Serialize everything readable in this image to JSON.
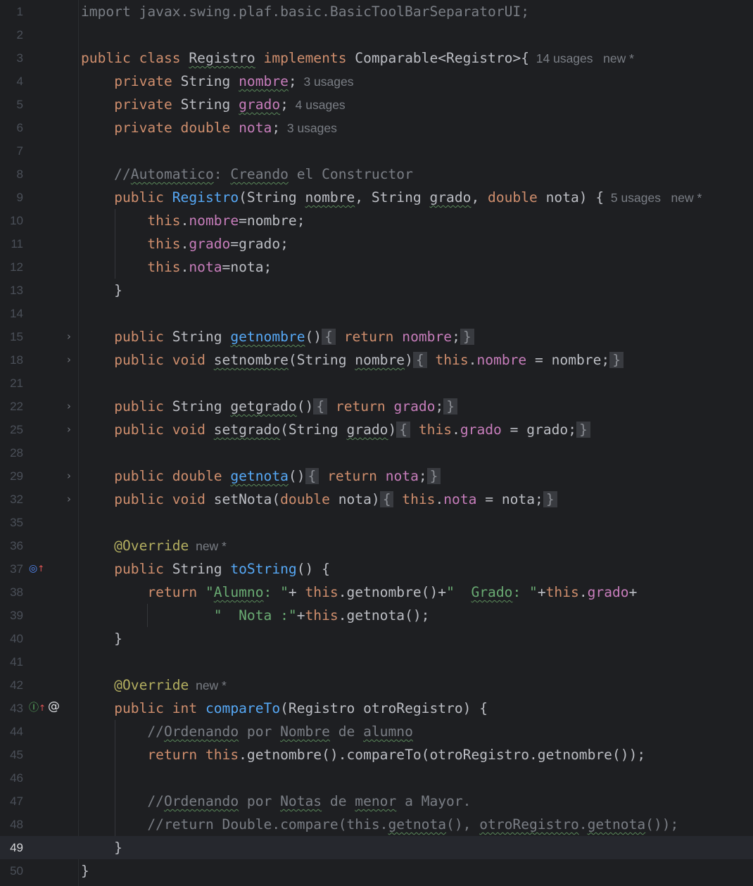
{
  "editor": {
    "language": "java",
    "current_line": "49",
    "colors": {
      "background": "#1e1f22",
      "keyword": "#cf8e6d",
      "field": "#c77dbb",
      "method": "#56a8f5",
      "string": "#6aab73",
      "comment": "#7a7e85",
      "annotation": "#b3ae60",
      "text": "#bcbec4"
    },
    "lines": [
      {
        "n": "1",
        "t": [
          [
            "cm",
            "import javax.swing.plaf.basic.BasicToolBarSeparatorUI;"
          ]
        ]
      },
      {
        "n": "2",
        "t": []
      },
      {
        "n": "3",
        "t": [
          [
            "kw",
            "public class "
          ],
          [
            "sq",
            "Registro"
          ],
          [
            "n",
            " "
          ],
          [
            "kw",
            "implements "
          ],
          [
            "n",
            "Comparable<Registro>{"
          ],
          [
            "h",
            "  14 usages   new *"
          ]
        ]
      },
      {
        "n": "4",
        "t": [
          [
            "n",
            "    "
          ],
          [
            "kw",
            "private "
          ],
          [
            "n",
            "String "
          ],
          [
            "fsq",
            "nombre"
          ],
          [
            "n",
            ";"
          ],
          [
            "h",
            "  3 usages"
          ]
        ]
      },
      {
        "n": "5",
        "t": [
          [
            "n",
            "    "
          ],
          [
            "kw",
            "private "
          ],
          [
            "n",
            "String "
          ],
          [
            "fsq",
            "grado"
          ],
          [
            "n",
            ";"
          ],
          [
            "h",
            "  4 usages"
          ]
        ]
      },
      {
        "n": "6",
        "t": [
          [
            "n",
            "    "
          ],
          [
            "kw",
            "private double "
          ],
          [
            "f",
            "nota"
          ],
          [
            "n",
            ";"
          ],
          [
            "h",
            "  3 usages"
          ]
        ]
      },
      {
        "n": "7",
        "t": []
      },
      {
        "n": "8",
        "t": [
          [
            "cm",
            "    //"
          ],
          [
            "cmsq",
            "Automatico"
          ],
          [
            "cm",
            ": "
          ],
          [
            "cmsq",
            "Creando"
          ],
          [
            "cm",
            " el Constructor"
          ]
        ]
      },
      {
        "n": "9",
        "t": [
          [
            "n",
            "    "
          ],
          [
            "kw",
            "public "
          ],
          [
            "fn",
            "Registro"
          ],
          [
            "n",
            "(String "
          ],
          [
            "sq",
            "nombre"
          ],
          [
            "n",
            ", String "
          ],
          [
            "sq",
            "grado"
          ],
          [
            "n",
            ", "
          ],
          [
            "kw",
            "double "
          ],
          [
            "n",
            "nota) {"
          ],
          [
            "h",
            "  5 usages   new *"
          ]
        ]
      },
      {
        "n": "10",
        "t": [
          [
            "n",
            "        "
          ],
          [
            "kw",
            "this"
          ],
          [
            "n",
            "."
          ],
          [
            "f",
            "nombre"
          ],
          [
            "n",
            "=nombre;"
          ]
        ]
      },
      {
        "n": "11",
        "t": [
          [
            "n",
            "        "
          ],
          [
            "kw",
            "this"
          ],
          [
            "n",
            "."
          ],
          [
            "f",
            "grado"
          ],
          [
            "n",
            "=grado;"
          ]
        ]
      },
      {
        "n": "12",
        "t": [
          [
            "n",
            "        "
          ],
          [
            "kw",
            "this"
          ],
          [
            "n",
            "."
          ],
          [
            "f",
            "nota"
          ],
          [
            "n",
            "=nota;"
          ]
        ]
      },
      {
        "n": "13",
        "t": [
          [
            "n",
            "    }"
          ]
        ]
      },
      {
        "n": "14",
        "t": []
      },
      {
        "n": "15",
        "fold": true,
        "t": [
          [
            "n",
            "    "
          ],
          [
            "kw",
            "public "
          ],
          [
            "n",
            "String "
          ],
          [
            "fnsq",
            "getnombre"
          ],
          [
            "n",
            "()"
          ],
          [
            "fb",
            "{"
          ],
          [
            "n",
            " "
          ],
          [
            "kw",
            "return "
          ],
          [
            "f",
            "nombre"
          ],
          [
            "n",
            ";"
          ],
          [
            "fb",
            "}"
          ]
        ]
      },
      {
        "n": "18",
        "fold": true,
        "t": [
          [
            "n",
            "    "
          ],
          [
            "kw",
            "public void "
          ],
          [
            "nmsq",
            "setnombre"
          ],
          [
            "n",
            "(String "
          ],
          [
            "sq",
            "nombre"
          ],
          [
            "n",
            ")"
          ],
          [
            "fb",
            "{"
          ],
          [
            "n",
            " "
          ],
          [
            "kw",
            "this"
          ],
          [
            "n",
            "."
          ],
          [
            "f",
            "nombre"
          ],
          [
            "n",
            " = nombre;"
          ],
          [
            "fb",
            "}"
          ]
        ]
      },
      {
        "n": "21",
        "t": []
      },
      {
        "n": "22",
        "fold": true,
        "t": [
          [
            "n",
            "    "
          ],
          [
            "kw",
            "public "
          ],
          [
            "n",
            "String "
          ],
          [
            "nmsq",
            "getgrado"
          ],
          [
            "n",
            "()"
          ],
          [
            "fb",
            "{"
          ],
          [
            "n",
            " "
          ],
          [
            "kw",
            "return "
          ],
          [
            "f",
            "grado"
          ],
          [
            "n",
            ";"
          ],
          [
            "fb",
            "}"
          ]
        ]
      },
      {
        "n": "25",
        "fold": true,
        "t": [
          [
            "n",
            "    "
          ],
          [
            "kw",
            "public void "
          ],
          [
            "nmsq",
            "setgrado"
          ],
          [
            "n",
            "(String "
          ],
          [
            "sq",
            "grado"
          ],
          [
            "n",
            ")"
          ],
          [
            "fb",
            "{"
          ],
          [
            "n",
            " "
          ],
          [
            "kw",
            "this"
          ],
          [
            "n",
            "."
          ],
          [
            "f",
            "grado"
          ],
          [
            "n",
            " = grado;"
          ],
          [
            "fb",
            "}"
          ]
        ]
      },
      {
        "n": "28",
        "t": []
      },
      {
        "n": "29",
        "fold": true,
        "t": [
          [
            "n",
            "    "
          ],
          [
            "kw",
            "public double "
          ],
          [
            "fnsq",
            "getnota"
          ],
          [
            "n",
            "()"
          ],
          [
            "fb",
            "{"
          ],
          [
            "n",
            " "
          ],
          [
            "kw",
            "return "
          ],
          [
            "f",
            "nota"
          ],
          [
            "n",
            ";"
          ],
          [
            "fb",
            "}"
          ]
        ]
      },
      {
        "n": "32",
        "fold": true,
        "t": [
          [
            "n",
            "    "
          ],
          [
            "kw",
            "public void "
          ],
          [
            "nm",
            "setNota"
          ],
          [
            "n",
            "("
          ],
          [
            "kw",
            "double "
          ],
          [
            "n",
            "nota)"
          ],
          [
            "fb",
            "{"
          ],
          [
            "n",
            " "
          ],
          [
            "kw",
            "this"
          ],
          [
            "n",
            "."
          ],
          [
            "f",
            "nota"
          ],
          [
            "n",
            " = nota;"
          ],
          [
            "fb",
            "}"
          ]
        ]
      },
      {
        "n": "35",
        "t": []
      },
      {
        "n": "36",
        "t": [
          [
            "a",
            "    @Override"
          ],
          [
            "h",
            "  new *"
          ]
        ]
      },
      {
        "n": "37",
        "icon": "override",
        "t": [
          [
            "n",
            "    "
          ],
          [
            "kw",
            "public "
          ],
          [
            "n",
            "String "
          ],
          [
            "fn",
            "toString"
          ],
          [
            "n",
            "() {"
          ]
        ]
      },
      {
        "n": "38",
        "t": [
          [
            "n",
            "        "
          ],
          [
            "kw",
            "return "
          ],
          [
            "s",
            "\""
          ],
          [
            "ssq",
            "Alumno"
          ],
          [
            "s",
            ": \""
          ],
          [
            "n",
            "+ "
          ],
          [
            "kw",
            "this"
          ],
          [
            "n",
            ".getnombre()+"
          ],
          [
            "s",
            "\"  "
          ],
          [
            "ssq",
            "Grado"
          ],
          [
            "s",
            ": \""
          ],
          [
            "n",
            "+"
          ],
          [
            "kw",
            "this"
          ],
          [
            "n",
            "."
          ],
          [
            "f",
            "grado"
          ],
          [
            "n",
            "+"
          ]
        ]
      },
      {
        "n": "39",
        "t": [
          [
            "n",
            "                "
          ],
          [
            "s",
            "\"  Nota :\""
          ],
          [
            "n",
            "+"
          ],
          [
            "kw",
            "this"
          ],
          [
            "n",
            ".getnota();"
          ]
        ]
      },
      {
        "n": "40",
        "t": [
          [
            "n",
            "    }"
          ]
        ]
      },
      {
        "n": "41",
        "t": []
      },
      {
        "n": "42",
        "t": [
          [
            "a",
            "    @Override"
          ],
          [
            "h",
            "  new *"
          ]
        ]
      },
      {
        "n": "43",
        "icon": "implement",
        "t": [
          [
            "n",
            "    "
          ],
          [
            "kw",
            "public int "
          ],
          [
            "fn",
            "compareTo"
          ],
          [
            "n",
            "(Registro otroRegistro) {"
          ]
        ]
      },
      {
        "n": "44",
        "t": [
          [
            "cm",
            "        //"
          ],
          [
            "cmsq",
            "Ordenando"
          ],
          [
            "cm",
            " por "
          ],
          [
            "cmsq",
            "Nombre"
          ],
          [
            "cm",
            " de "
          ],
          [
            "cmsq",
            "alumno"
          ]
        ]
      },
      {
        "n": "45",
        "t": [
          [
            "n",
            "        "
          ],
          [
            "kw",
            "return this"
          ],
          [
            "n",
            ".getnombre().compareTo(otroRegistro.getnombre());"
          ]
        ]
      },
      {
        "n": "46",
        "t": []
      },
      {
        "n": "47",
        "t": [
          [
            "cm",
            "        //"
          ],
          [
            "cmsq",
            "Ordenando"
          ],
          [
            "cm",
            " por "
          ],
          [
            "cmsq",
            "Notas"
          ],
          [
            "cm",
            " de "
          ],
          [
            "cmsq",
            "menor"
          ],
          [
            "cm",
            " a Mayor."
          ]
        ]
      },
      {
        "n": "48",
        "t": [
          [
            "cm",
            "        //return Double.compare(this."
          ],
          [
            "cmsq",
            "getnota"
          ],
          [
            "cm",
            "(), "
          ],
          [
            "cmsq",
            "otroRegistro"
          ],
          [
            "cm",
            "."
          ],
          [
            "cmsq",
            "getnota"
          ],
          [
            "cm",
            "());"
          ]
        ]
      },
      {
        "n": "49",
        "t": [
          [
            "n",
            "    }"
          ]
        ]
      },
      {
        "n": "50",
        "t": [
          [
            "n",
            "}"
          ]
        ]
      }
    ]
  }
}
